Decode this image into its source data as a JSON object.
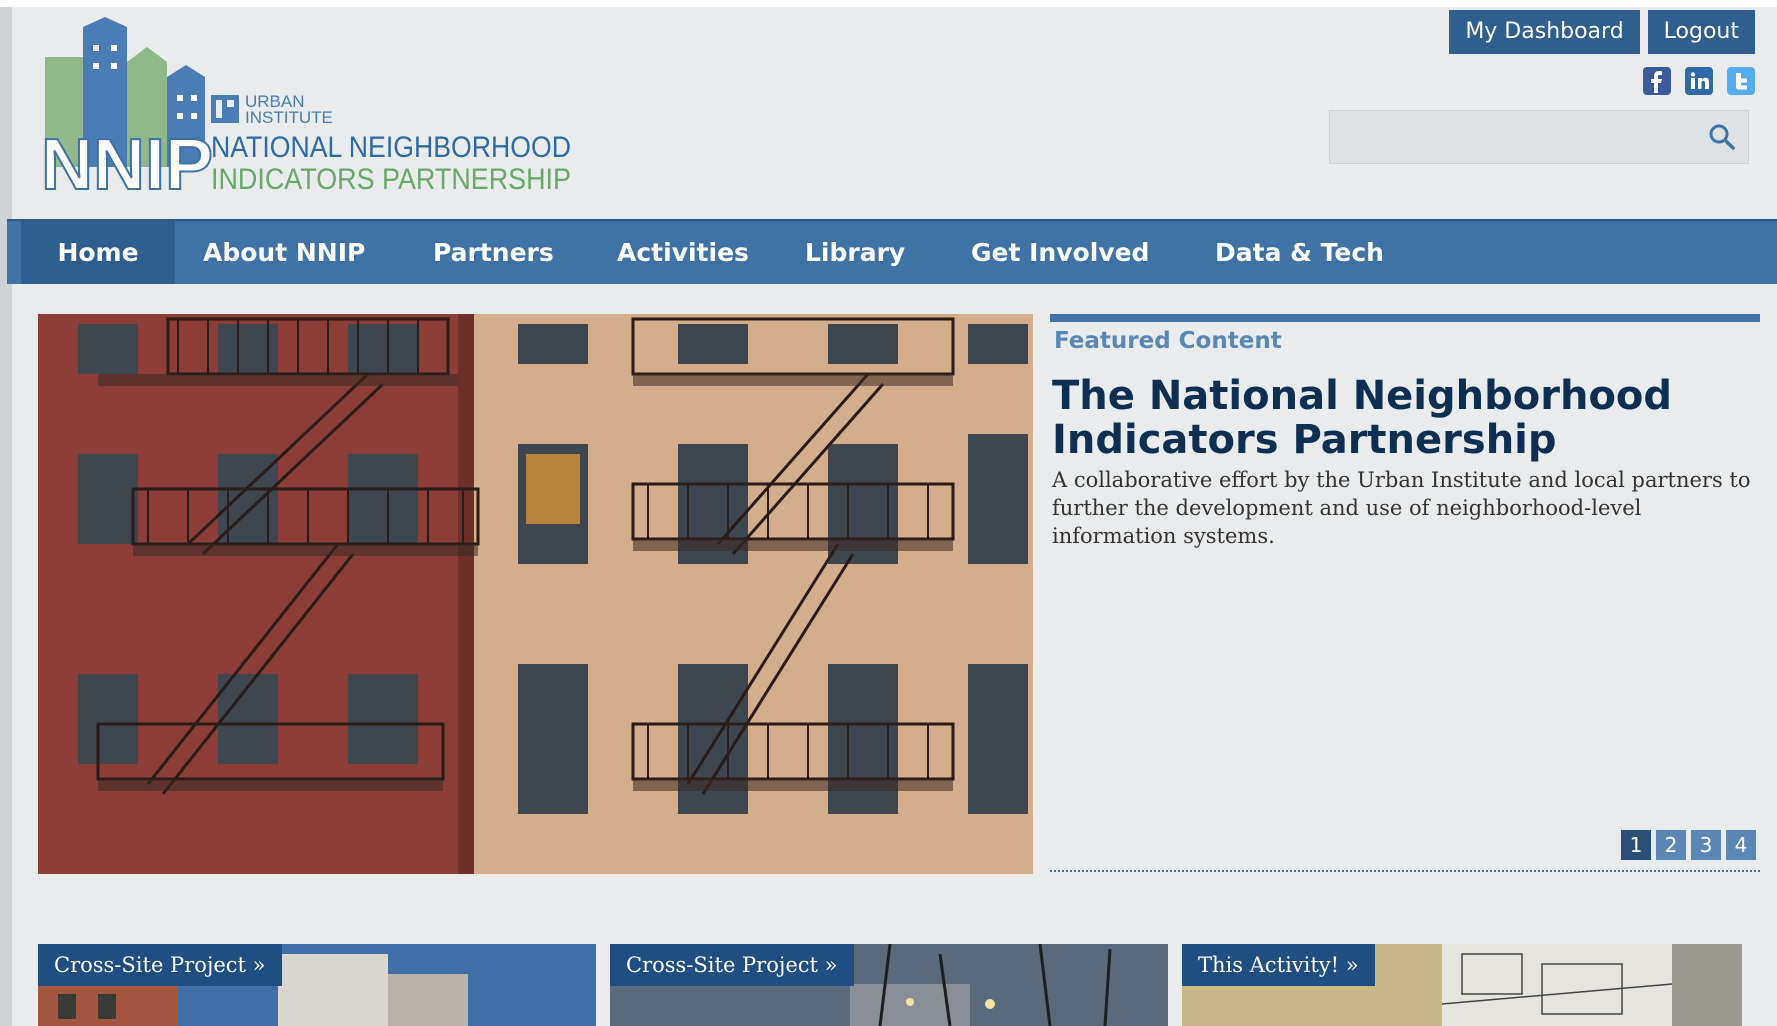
{
  "header": {
    "logo": {
      "mark": "NNIP",
      "parent": "URBAN\nINSTITUTE",
      "line1": "NATIONAL NEIGHBORHOOD",
      "line2": "INDICATORS PARTNERSHIP"
    },
    "buttons": {
      "dashboard": "My Dashboard",
      "logout": "Logout"
    },
    "social": [
      "facebook-icon",
      "linkedin-icon",
      "twitter-icon"
    ],
    "search": {
      "placeholder": ""
    }
  },
  "nav": {
    "items": [
      {
        "label": "Home",
        "active": true
      },
      {
        "label": "About NNIP"
      },
      {
        "label": "Partners"
      },
      {
        "label": "Activities"
      },
      {
        "label": "Library"
      },
      {
        "label": "Get Involved"
      },
      {
        "label": "Data & Tech"
      }
    ]
  },
  "featured": {
    "label": "Featured Content",
    "title": "The National Neighborhood Indicators Partnership",
    "description": "A collaborative effort by the Urban Institute and local partners to further the development and use of neighborhood-level information systems.",
    "pages": [
      "1",
      "2",
      "3",
      "4"
    ],
    "active_page": "1"
  },
  "tiles": [
    {
      "label": "Cross-Site Project »"
    },
    {
      "label": "Cross-Site Project »"
    },
    {
      "label": "This Activity! »"
    }
  ],
  "colors": {
    "nav": "#3f73a6",
    "nav_active": "#2f5f8e",
    "title": "#0f2f52",
    "accent": "#5b87b4"
  }
}
